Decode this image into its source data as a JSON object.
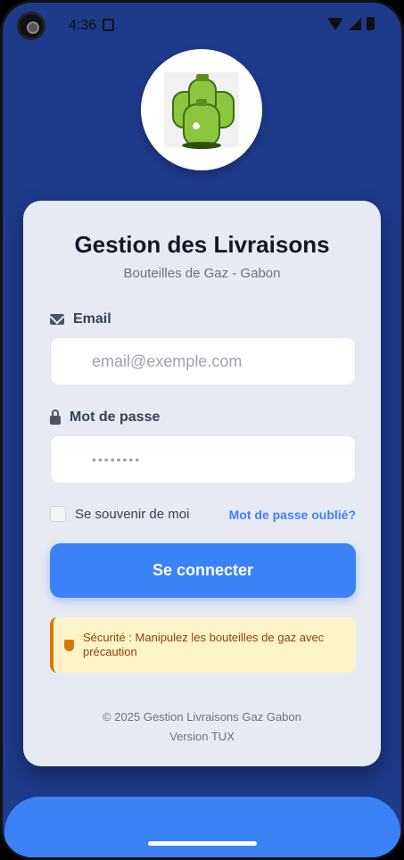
{
  "status_bar": {
    "time": "4:36",
    "icons": [
      "notification-icon",
      "wifi-icon",
      "signal-icon",
      "battery-icon"
    ]
  },
  "logo": {
    "icon": "gas-cylinder-icon"
  },
  "card": {
    "title": "Gestion des Livraisons",
    "subtitle": "Bouteilles de Gaz - Gabon"
  },
  "form": {
    "email_label": "Email",
    "email_placeholder": "email@exemple.com",
    "email_value": "",
    "password_label": "Mot de passe",
    "password_placeholder": "••••••••",
    "password_value": "",
    "remember_label": "Se souvenir de moi",
    "remember_checked": false,
    "forgot_label": "Mot de passe oublié?",
    "submit_label": "Se connecter"
  },
  "alert": {
    "text": "Sécurité : Manipulez les bouteilles de gaz avec précaution",
    "icon": "shield-icon"
  },
  "footer": {
    "copyright": "© 2025 Gestion Livraisons Gaz Gabon",
    "version": "Version TUX"
  },
  "colors": {
    "background": "#1e3a8a",
    "primary": "#3b82f6",
    "card": "#e7eaf3",
    "alert_bg": "#fdf3c8",
    "alert_accent": "#d97706"
  }
}
